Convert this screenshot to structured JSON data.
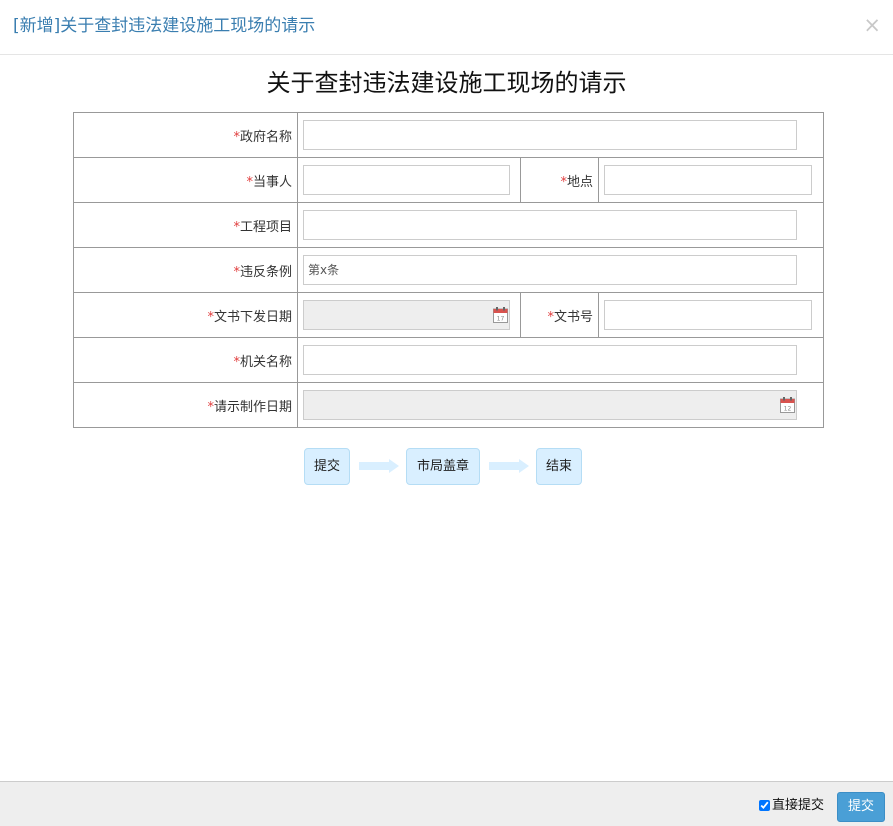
{
  "dialog": {
    "title": "[新增]关于查封违法建设施工现场的请示",
    "close_label": "×"
  },
  "document": {
    "title": "关于查封违法建设施工现场的请示"
  },
  "form": {
    "required_mark": "*",
    "fields": {
      "government_name": {
        "label": "政府名称",
        "value": ""
      },
      "party": {
        "label": "当事人",
        "value": ""
      },
      "location": {
        "label": "地点",
        "value": ""
      },
      "project": {
        "label": "工程项目",
        "value": ""
      },
      "violated_article": {
        "label": "违反条例",
        "value": "",
        "placeholder": "第x条"
      },
      "issue_date": {
        "label": "文书下发日期",
        "value": "",
        "icon": "calendar-icon"
      },
      "doc_number": {
        "label": "文书号",
        "value": ""
      },
      "agency_name": {
        "label": "机关名称",
        "value": ""
      },
      "request_date": {
        "label": "请示制作日期",
        "value": "",
        "icon": "calendar-icon"
      }
    }
  },
  "workflow": {
    "steps": [
      {
        "label": "提交"
      },
      {
        "label": "市局盖章"
      },
      {
        "label": "结束"
      }
    ],
    "arrow_icon": "arrow-right-icon"
  },
  "footer": {
    "direct_submit_label": "直接提交",
    "direct_submit_checked": true,
    "submit_label": "提交"
  },
  "colors": {
    "title_blue": "#3a7eb0",
    "required_red": "#e03c3c",
    "step_bg": "#d9efff",
    "submit_bg": "#4a9fd6",
    "footer_bg": "#eeeeee"
  }
}
